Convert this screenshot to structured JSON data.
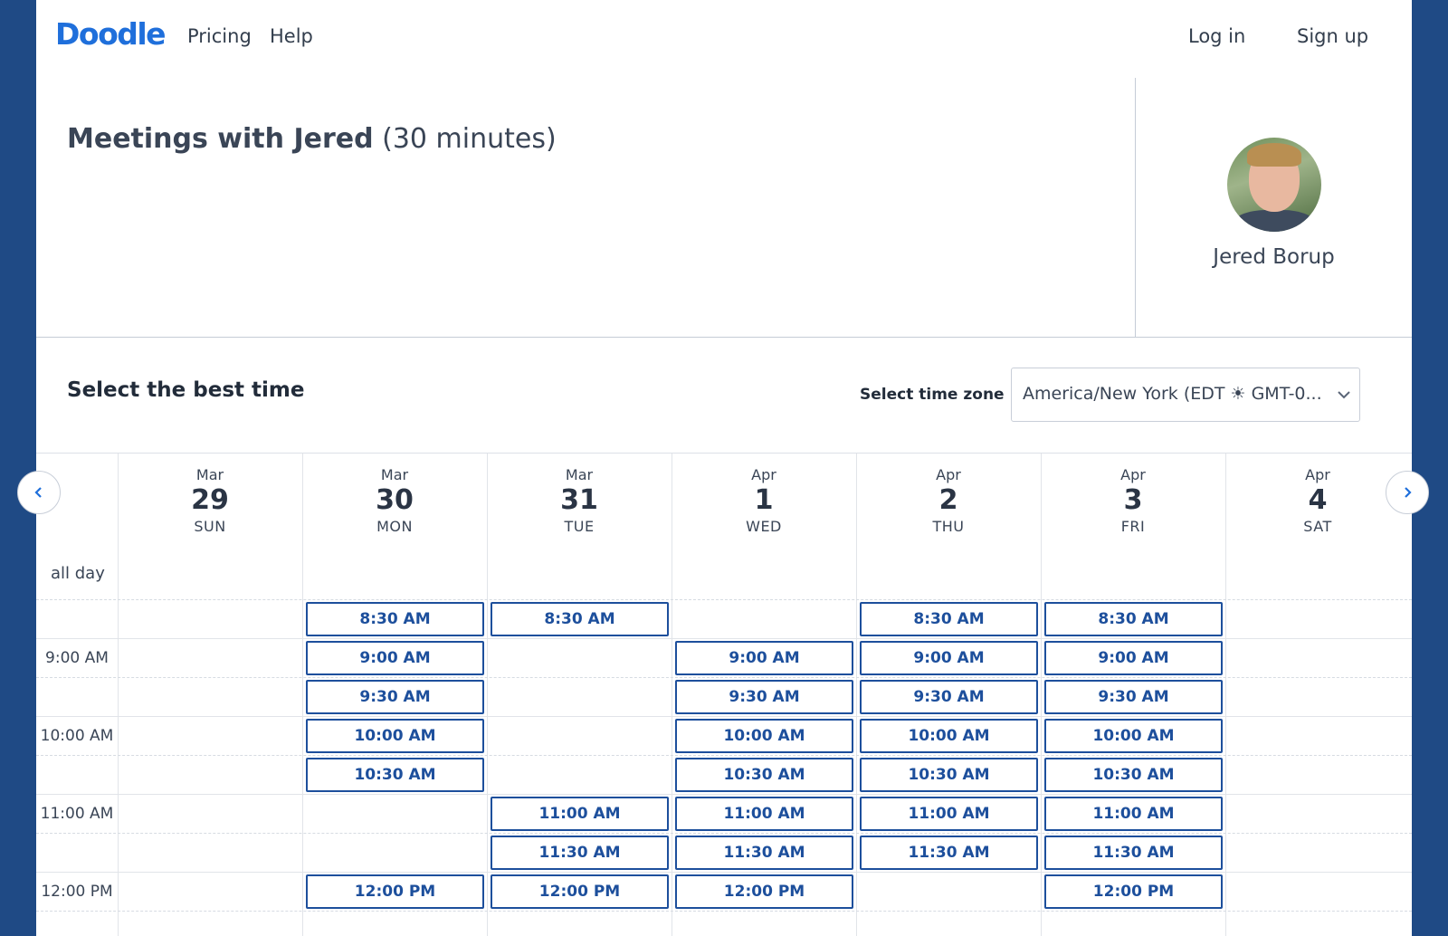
{
  "nav": {
    "logo": "Doodle",
    "pricing": "Pricing",
    "help": "Help",
    "login": "Log in",
    "signup": "Sign up"
  },
  "header": {
    "title_name": "Meetings with Jered",
    "title_duration": "(30 minutes)"
  },
  "host": {
    "name": "Jered Borup"
  },
  "scheduler": {
    "heading": "Select the best time",
    "timezone_label": "Select time zone",
    "timezone_value": "America/New York (EDT ☀ GMT-0..."
  },
  "calendar": {
    "allday_label": "all day",
    "days": [
      {
        "month": "Mar",
        "day": "29",
        "weekday": "SUN"
      },
      {
        "month": "Mar",
        "day": "30",
        "weekday": "MON"
      },
      {
        "month": "Mar",
        "day": "31",
        "weekday": "TUE"
      },
      {
        "month": "Apr",
        "day": "1",
        "weekday": "WED"
      },
      {
        "month": "Apr",
        "day": "2",
        "weekday": "THU"
      },
      {
        "month": "Apr",
        "day": "3",
        "weekday": "FRI"
      },
      {
        "month": "Apr",
        "day": "4",
        "weekday": "SAT"
      }
    ],
    "time_labels": [
      "9:00 AM",
      "10:00 AM",
      "11:00 AM",
      "12:00 PM"
    ],
    "slot_rows": [
      "8:30 AM",
      "9:00 AM",
      "9:30 AM",
      "10:00 AM",
      "10:30 AM",
      "11:00 AM",
      "11:30 AM",
      "12:00 PM"
    ],
    "availability": [
      [],
      [
        "8:30 AM",
        "9:00 AM",
        "9:30 AM",
        "10:00 AM",
        "10:30 AM",
        "12:00 PM"
      ],
      [
        "8:30 AM",
        "11:00 AM",
        "11:30 AM",
        "12:00 PM"
      ],
      [
        "9:00 AM",
        "9:30 AM",
        "10:00 AM",
        "10:30 AM",
        "11:00 AM",
        "11:30 AM",
        "12:00 PM"
      ],
      [
        "8:30 AM",
        "9:00 AM",
        "9:30 AM",
        "10:00 AM",
        "10:30 AM",
        "11:00 AM",
        "11:30 AM"
      ],
      [
        "8:30 AM",
        "9:00 AM",
        "9:30 AM",
        "10:00 AM",
        "10:30 AM",
        "11:00 AM",
        "11:30 AM",
        "12:00 PM"
      ],
      []
    ]
  },
  "colors": {
    "frame": "#1f4a85",
    "brand": "#1f6fdb",
    "slot_border": "#1d4f9c"
  },
  "icons": {
    "prev": "chevron-left-icon",
    "next": "chevron-right-icon",
    "select": "chevron-down-icon"
  }
}
